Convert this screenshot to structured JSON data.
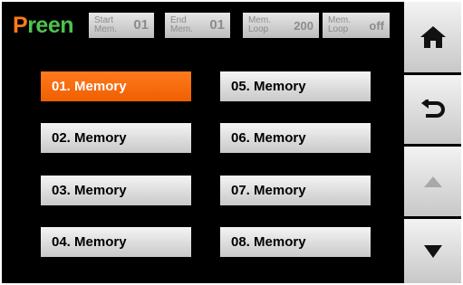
{
  "logo": {
    "first_letter": "P",
    "rest": "reen"
  },
  "status_chips": [
    {
      "label": "Start Mem.",
      "value": "01"
    },
    {
      "label": "End Mem.",
      "value": "01"
    },
    {
      "label": "Mem. Loop",
      "value": "200"
    },
    {
      "label": "Mem. Loop",
      "value": "off"
    }
  ],
  "memories": [
    {
      "label": "01. Memory",
      "selected": true
    },
    {
      "label": "02. Memory",
      "selected": false
    },
    {
      "label": "03. Memory",
      "selected": false
    },
    {
      "label": "04. Memory",
      "selected": false
    },
    {
      "label": "05. Memory",
      "selected": false
    },
    {
      "label": "06. Memory",
      "selected": false
    },
    {
      "label": "07. Memory",
      "selected": false
    },
    {
      "label": "08. Memory",
      "selected": false
    }
  ],
  "side_buttons": [
    {
      "icon": "home-icon"
    },
    {
      "icon": "back-arrow-icon"
    },
    {
      "icon": "scroll-up-icon",
      "disabled": true
    },
    {
      "icon": "scroll-down-icon",
      "disabled": false
    }
  ],
  "colors": {
    "background": "#000000",
    "accent_orange": "#ff7a1c",
    "logo_green": "#4fc24f",
    "disabled_icon": "#a8a8a8"
  }
}
